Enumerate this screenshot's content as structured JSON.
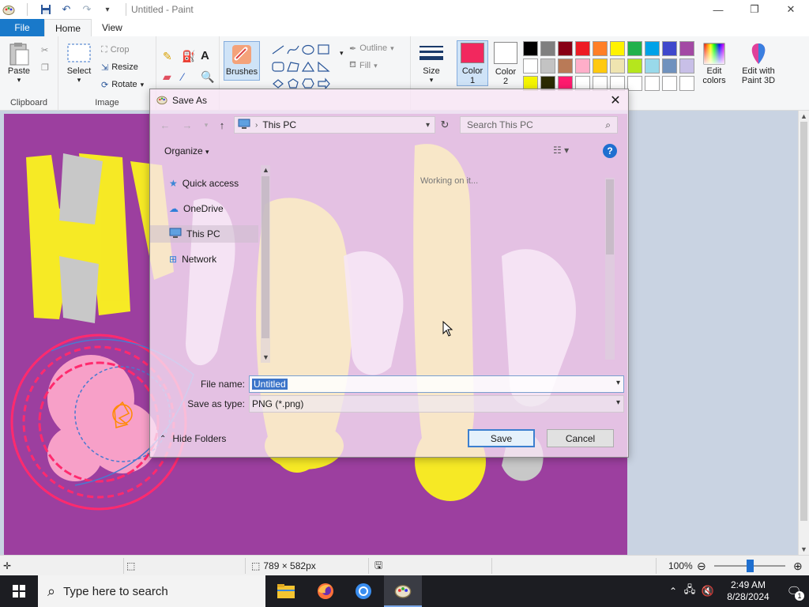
{
  "window": {
    "title": "Untitled - Paint"
  },
  "tabs": [
    {
      "label": "File"
    },
    {
      "label": "Home"
    },
    {
      "label": "View"
    }
  ],
  "ribbon": {
    "clipboard": {
      "label": "Clipboard",
      "paste": "Paste"
    },
    "image": {
      "label": "Image",
      "select": "Select",
      "crop": "Crop",
      "resize": "Resize",
      "rotate": "Rotate"
    },
    "tools": {
      "brushes": "Brushes"
    },
    "shapes": {
      "outline": "Outline",
      "fill": "Fill"
    },
    "size": "Size",
    "color1": {
      "label": "Color",
      "sub": "1",
      "value": "#f2285e"
    },
    "color2": {
      "label": "Color",
      "sub": "2",
      "value": "#ffffff"
    },
    "edit_colors": "Edit colors",
    "paint3d": "Edit with Paint 3D",
    "palette_row1": [
      "#000000",
      "#7f7f7f",
      "#880015",
      "#ed1c24",
      "#ff7f27",
      "#fff200",
      "#22b14c",
      "#00a2e8",
      "#3f48cc",
      "#a349a4"
    ],
    "palette_row2": [
      "#ffffff",
      "#c3c3c3",
      "#b97a57",
      "#ffaec9",
      "#ffc90e",
      "#efe4b0",
      "#b5e61d",
      "#99d9ea",
      "#7092be",
      "#c8bfe7"
    ],
    "palette_row3": [
      "#f5f500",
      "#2b2b00",
      "#ff1a6e",
      "#ffffff",
      "#ffffff",
      "#ffffff",
      "#ffffff",
      "#ffffff",
      "#ffffff",
      "#ffffff"
    ]
  },
  "dialog": {
    "title": "Save As",
    "address": "This PC",
    "search_placeholder": "Search This PC",
    "organize": "Organize",
    "nav": [
      {
        "label": "Quick access",
        "icon": "star-icon"
      },
      {
        "label": "OneDrive",
        "icon": "cloud-icon"
      },
      {
        "label": "This PC",
        "icon": "monitor-icon"
      },
      {
        "label": "Network",
        "icon": "network-icon"
      }
    ],
    "status": "Working on it...",
    "file_name_label": "File name:",
    "file_name_value": "Untitled",
    "save_type_label": "Save as type:",
    "save_type_value": "PNG (*.png)",
    "hide_folders": "Hide Folders",
    "save": "Save",
    "cancel": "Cancel"
  },
  "statusbar": {
    "dimensions": "789 × 582px",
    "zoom": "100%",
    "zoom_level": 0.5
  },
  "taskbar": {
    "search_placeholder": "Type here to search",
    "time": "2:49 AM",
    "date": "8/28/2024",
    "notifications": "1"
  }
}
